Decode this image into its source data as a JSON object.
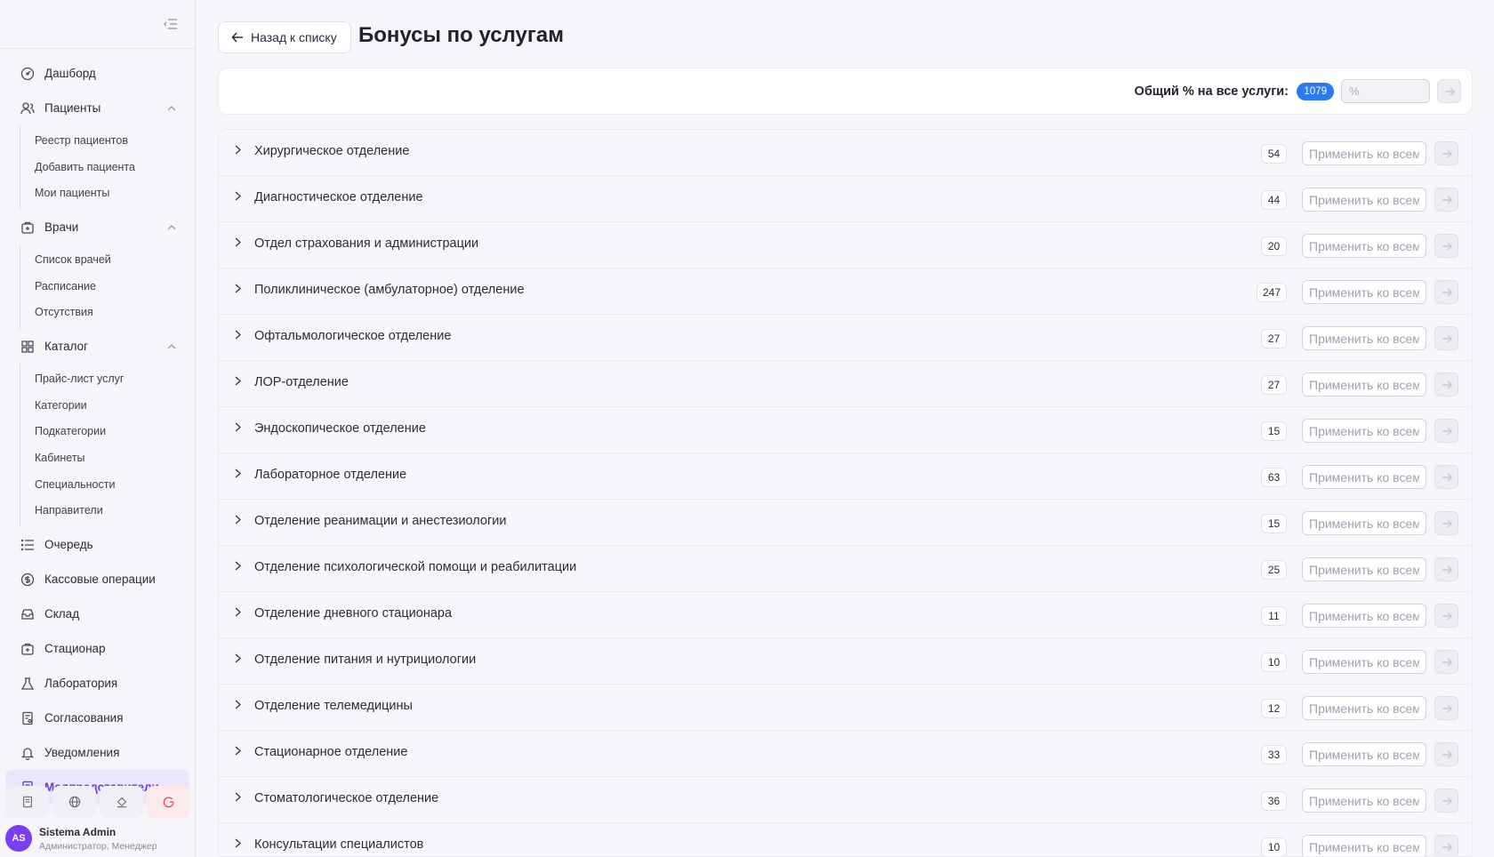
{
  "sidebar": {
    "items": [
      {
        "label": "Дашборд",
        "icon": "dashboard-icon"
      },
      {
        "label": "Пациенты",
        "icon": "patients-icon",
        "expanded": true,
        "children": [
          "Реестр пациентов",
          "Добавить пациента",
          "Мои пациенты"
        ]
      },
      {
        "label": "Врачи",
        "icon": "doctors-icon",
        "expanded": true,
        "children": [
          "Список врачей",
          "Расписание",
          "Отсутствия"
        ]
      },
      {
        "label": "Каталог",
        "icon": "catalog-icon",
        "expanded": true,
        "children": [
          "Прайс-лист услуг",
          "Категории",
          "Подкатегории",
          "Кабинеты",
          "Специальности",
          "Направители"
        ]
      },
      {
        "label": "Очередь",
        "icon": "queue-icon"
      },
      {
        "label": "Кассовые операции",
        "icon": "cash-icon"
      },
      {
        "label": "Склад",
        "icon": "warehouse-icon"
      },
      {
        "label": "Стационар",
        "icon": "hospital-icon"
      },
      {
        "label": "Лаборатория",
        "icon": "flask-icon"
      },
      {
        "label": "Согласования",
        "icon": "approvals-icon"
      },
      {
        "label": "Уведомления",
        "icon": "bell-icon"
      },
      {
        "label": "Медпредставители",
        "icon": "med-reps-icon",
        "active": true
      }
    ],
    "user": {
      "initials": "AS",
      "name": "Sistema Admin",
      "role": "Администратор, Менеджер"
    }
  },
  "header": {
    "back_label": "Назад к списку",
    "title": "Бонусы по услугам"
  },
  "total": {
    "label": "Общий % на все услуги:",
    "badge": "1079",
    "placeholder": "%"
  },
  "departments": {
    "apply_placeholder": "Применить ко всем",
    "rows": [
      {
        "name": "Хирургическое отделение",
        "count": "54"
      },
      {
        "name": "Диагностическое отделение",
        "count": "44"
      },
      {
        "name": "Отдел страхования и администрации",
        "count": "20"
      },
      {
        "name": "Поликлиническое (амбулаторное) отделение",
        "count": "247"
      },
      {
        "name": "Офтальмологическое отделение",
        "count": "27"
      },
      {
        "name": "ЛОР-отделение",
        "count": "27"
      },
      {
        "name": "Эндоскопическое отделение",
        "count": "15"
      },
      {
        "name": "Лабораторное отделение",
        "count": "63"
      },
      {
        "name": "Отделение реанимации и анестезиологии",
        "count": "15"
      },
      {
        "name": "Отделение психологической помощи и реабилитации",
        "count": "25"
      },
      {
        "name": "Отделение дневного стационара",
        "count": "11"
      },
      {
        "name": "Отделение питания и нутрициологии",
        "count": "10"
      },
      {
        "name": "Отделение телемедицины",
        "count": "12"
      },
      {
        "name": "Стационарное отделение",
        "count": "33"
      },
      {
        "name": "Стоматологическое отделение",
        "count": "36"
      },
      {
        "name": "Консультации специалистов",
        "count": "10"
      }
    ]
  },
  "colors": {
    "accent": "#6d3fd6",
    "badge": "#2b7bf0",
    "avatar": "#7a3ff0"
  }
}
